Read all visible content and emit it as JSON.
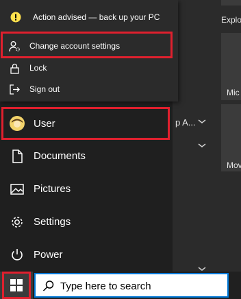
{
  "account_flyout": {
    "alert": {
      "text": "Action advised — back up your PC",
      "icon": "warning-circle-icon",
      "color": "#ffe14d"
    },
    "items": [
      {
        "label": "Change account settings",
        "icon": "person-gear-icon"
      },
      {
        "label": "Lock",
        "icon": "lock-icon"
      },
      {
        "label": "Sign out",
        "icon": "sign-out-icon"
      }
    ]
  },
  "rail": {
    "user": {
      "label": "User",
      "icon": "user-avatar-icon"
    },
    "items": [
      {
        "label": "Documents",
        "icon": "document-icon"
      },
      {
        "label": "Pictures",
        "icon": "pictures-icon"
      },
      {
        "label": "Settings",
        "icon": "gear-icon"
      },
      {
        "label": "Power",
        "icon": "power-icon"
      }
    ]
  },
  "tiles_area": {
    "labels": [
      "Explo",
      "Mic",
      "Mov"
    ],
    "group_label": "p A..."
  },
  "taskbar": {
    "start_icon": "windows-logo-icon",
    "search_placeholder": "Type here to search",
    "search_icon": "search-icon"
  },
  "highlight_color": "#e0202e",
  "accent_color": "#0078d7"
}
